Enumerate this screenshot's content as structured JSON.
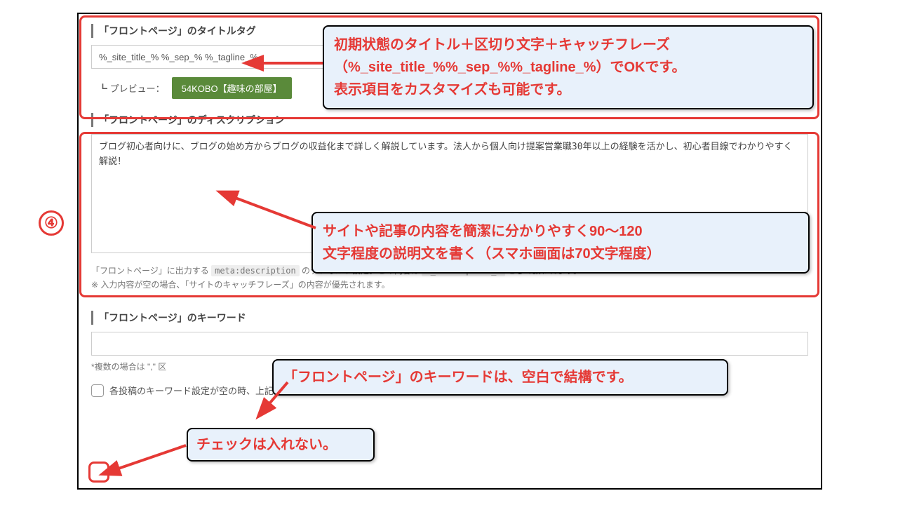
{
  "step_number": "④",
  "section1": {
    "title": "「フロントページ」のタイトルタグ",
    "input_value": "%_site_title_% %_sep_% %_tagline_%",
    "preview_label": "┗ プレビュー：",
    "preview_badge": "54KOBO【趣味の部屋】"
  },
  "section2": {
    "title": "「フロントページ」のディスクリプション",
    "textarea_value": "ブログ初心者向けに、ブログの始め方からブログの収益化まで詳しく解説しています。法人から個人向け提案営業職30年以上の経験を活かし、初心者目線でわかりやすく解説！",
    "hint_prefix": "「フロントページ」に出力する ",
    "hint_code1": "meta:description",
    "hint_mid": " のデフォルト設定。この内容は ",
    "hint_code2": "%_description_%",
    "hint_suffix": " として扱われます。",
    "hint_line2": "※ 入力内容が空の場合、「サイトのキャッチフレーズ」の内容が優先されます。"
  },
  "section3": {
    "title": "「フロントページ」のキーワード",
    "input_value": "",
    "note": "*複数の場合は \",\" 区",
    "checkbox_label": "各投稿のキーワード設定が空の時、上記と同じキーワードを出力"
  },
  "callouts": {
    "c1_line1": "初期状態のタイトル＋区切り文字＋キャッチフレーズ",
    "c1_line2_open": "（",
    "c1_line2_code": "%_site_title_%%_sep_%%_tagline_%",
    "c1_line2_close": "）でOKです。",
    "c1_line3": "表示項目をカスタマイズも可能です。",
    "c2_line1": "サイトや記事の内容を簡潔に分かりやすく90～120",
    "c2_line2": "文字程度の説明文を書く（スマホ画面は70文字程度）",
    "c3": "「フロントページ」のキーワードは、空白で結構です。",
    "c4": "チェックは入れない。"
  }
}
